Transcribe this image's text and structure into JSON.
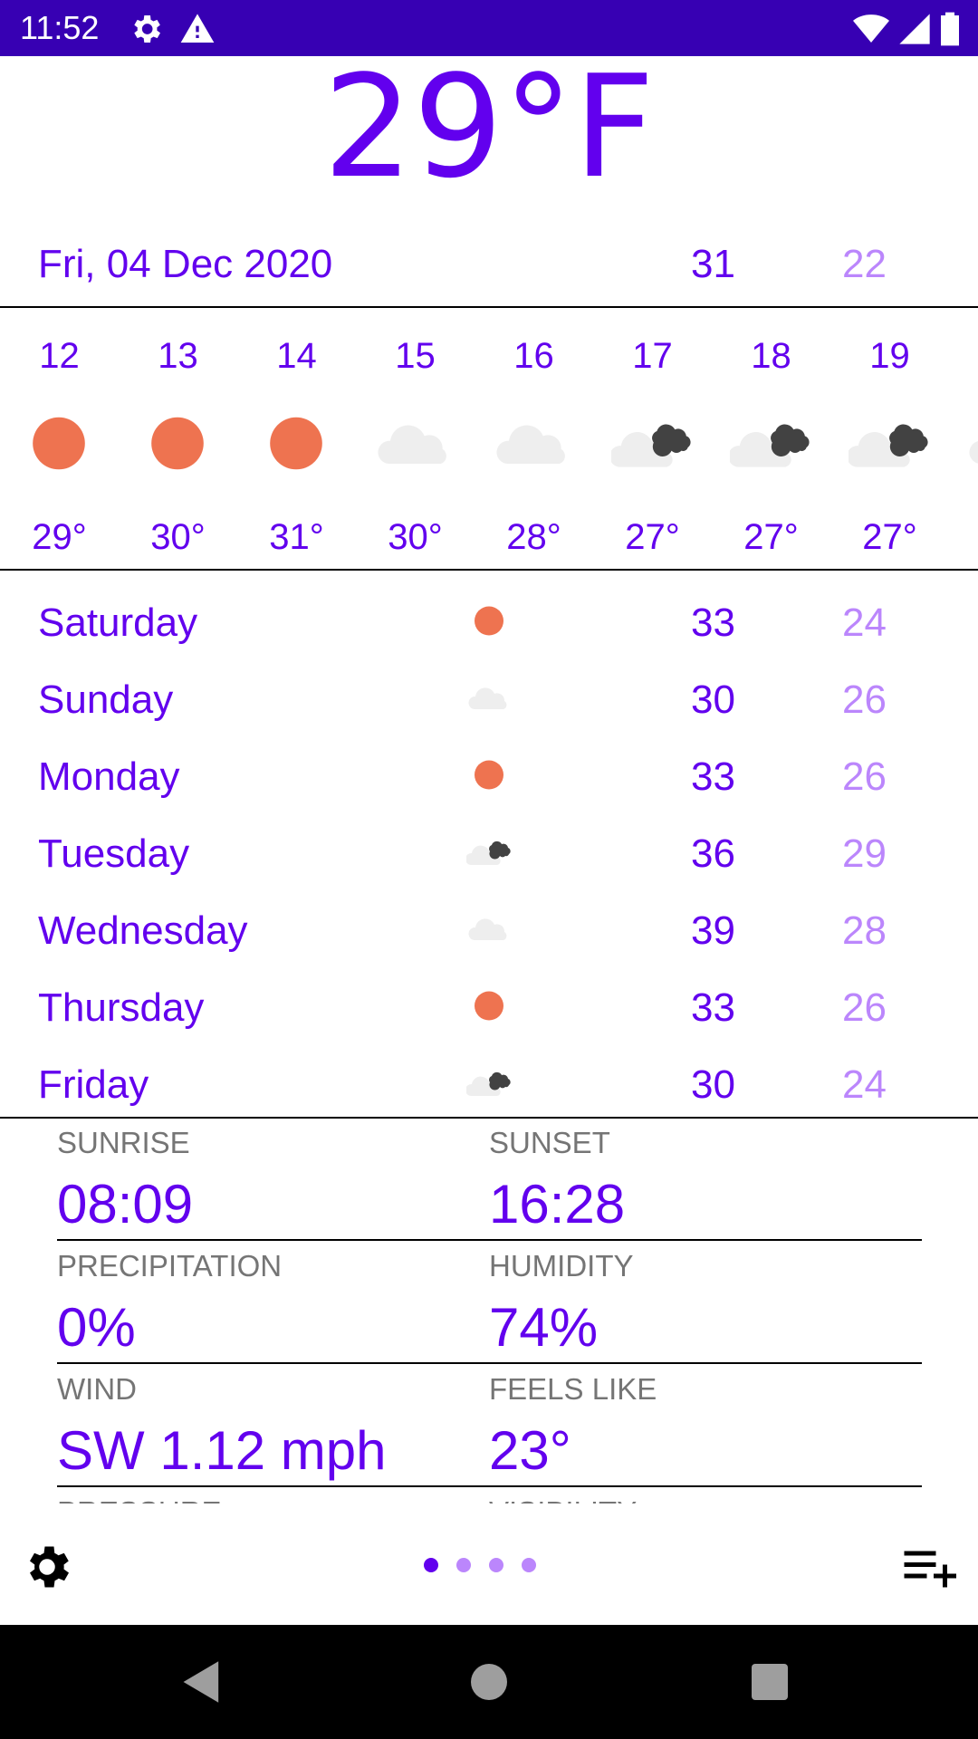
{
  "status_bar": {
    "time": "11:52",
    "icons": [
      "gear-icon",
      "warning-icon",
      "wifi-icon",
      "signal-icon",
      "battery-icon"
    ],
    "background": "#3700b3"
  },
  "current": {
    "temperature": "29°F"
  },
  "today": {
    "date": "Fri, 04 Dec 2020",
    "high": "31",
    "low": "22"
  },
  "hourly": [
    {
      "hour": "12",
      "icon": "sun-icon",
      "temp": "29°"
    },
    {
      "hour": "13",
      "icon": "sun-icon",
      "temp": "30°"
    },
    {
      "hour": "14",
      "icon": "sun-icon",
      "temp": "31°"
    },
    {
      "hour": "15",
      "icon": "cloud-icon",
      "temp": "30°"
    },
    {
      "hour": "16",
      "icon": "cloud-icon",
      "temp": "28°"
    },
    {
      "hour": "17",
      "icon": "cloudy-dark-icon",
      "temp": "27°"
    },
    {
      "hour": "18",
      "icon": "cloudy-dark-icon",
      "temp": "27°"
    },
    {
      "hour": "19",
      "icon": "cloudy-dark-icon",
      "temp": "27°"
    }
  ],
  "daily": [
    {
      "day": "Saturday",
      "icon": "sun-icon",
      "high": "33",
      "low": "24"
    },
    {
      "day": "Sunday",
      "icon": "cloud-icon",
      "high": "30",
      "low": "26"
    },
    {
      "day": "Monday",
      "icon": "sun-icon",
      "high": "33",
      "low": "26"
    },
    {
      "day": "Tuesday",
      "icon": "cloudy-dark-icon",
      "high": "36",
      "low": "29"
    },
    {
      "day": "Wednesday",
      "icon": "cloud-icon",
      "high": "39",
      "low": "28"
    },
    {
      "day": "Thursday",
      "icon": "sun-icon",
      "high": "33",
      "low": "26"
    },
    {
      "day": "Friday",
      "icon": "cloudy-dark-icon",
      "high": "30",
      "low": "24"
    }
  ],
  "details": {
    "sunrise_label": "SUNRISE",
    "sunrise_value": "08:09",
    "sunset_label": "SUNSET",
    "sunset_value": "16:28",
    "precipitation_label": "PRECIPITATION",
    "precipitation_value": "0%",
    "humidity_label": "HUMIDITY",
    "humidity_value": "74%",
    "wind_label": "WIND",
    "wind_value": "SW 1.12 mph",
    "feels_like_label": "FEELS LIKE",
    "feels_like_value": "23°",
    "pressure_label": "PRESSURE",
    "visibility_label": "VISIBILITY"
  },
  "pager": {
    "total": 4,
    "active": 0
  },
  "bottom_bar": {
    "left_icon": "gear-icon",
    "right_icon": "playlist-add-icon"
  },
  "colors": {
    "primary": "#6200ee",
    "primary_light": "#bb86fc",
    "sun": "#ee7350",
    "cloud": "#eeeeee",
    "dark_cloud": "#424242",
    "label_gray": "#757575"
  }
}
